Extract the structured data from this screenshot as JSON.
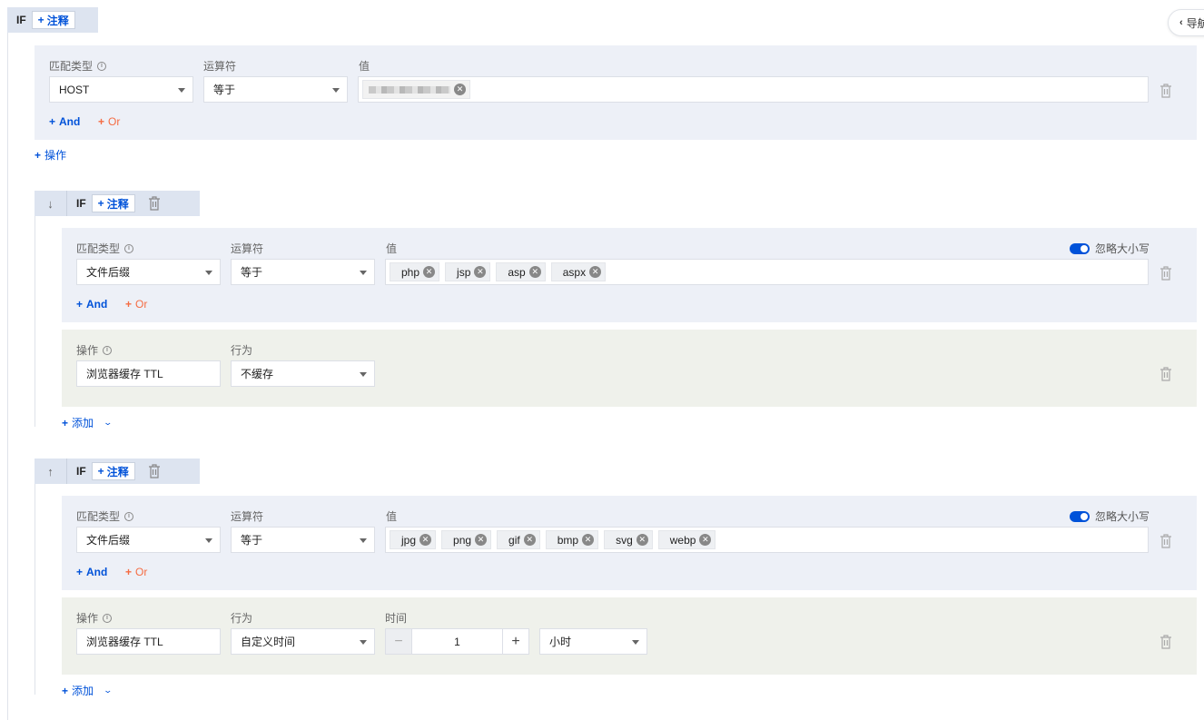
{
  "guide": {
    "label": "导航"
  },
  "labels": {
    "match_type": "匹配类型",
    "operator": "运算符",
    "value": "值",
    "operation": "操作",
    "behavior": "行为",
    "time": "时间",
    "ignore_case": "忽略大小写",
    "if": "IF",
    "note": "注释",
    "and": "And",
    "or": "Or",
    "add_operation": "操作",
    "add": "添加",
    "plus": "+"
  },
  "rule1": {
    "match_type": "HOST",
    "operator": "等于",
    "values": [
      "(redacted host)"
    ]
  },
  "rule2": {
    "match_type": "文件后缀",
    "operator": "等于",
    "values": [
      "php",
      "jsp",
      "asp",
      "aspx"
    ],
    "operation": "浏览器缓存 TTL",
    "behavior": "不缓存"
  },
  "rule3": {
    "match_type": "文件后缀",
    "operator": "等于",
    "values": [
      "jpg",
      "png",
      "gif",
      "bmp",
      "svg",
      "webp"
    ],
    "operation": "浏览器缓存 TTL",
    "behavior": "自定义时间",
    "time_value": "1",
    "time_unit": "小时"
  },
  "colors": {
    "accent": "#0052d9",
    "or": "#f56c43",
    "cond_bg": "#edf0f7",
    "op_bg": "#eff1eb",
    "header_bg": "#dde4f0"
  }
}
